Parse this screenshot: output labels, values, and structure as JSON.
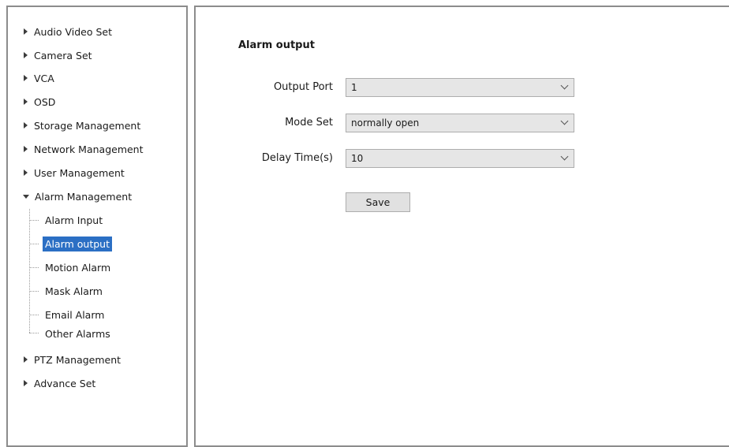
{
  "sidebar": {
    "items": [
      {
        "label": "Audio Video Set"
      },
      {
        "label": "Camera Set"
      },
      {
        "label": "VCA"
      },
      {
        "label": "OSD"
      },
      {
        "label": "Storage Management"
      },
      {
        "label": "Network Management"
      },
      {
        "label": "User Management"
      },
      {
        "label": "Alarm Management"
      },
      {
        "label": "PTZ Management"
      },
      {
        "label": "Advance Set"
      }
    ],
    "alarm_children": [
      {
        "label": "Alarm Input"
      },
      {
        "label": "Alarm output",
        "selected": true
      },
      {
        "label": "Motion Alarm"
      },
      {
        "label": "Mask Alarm"
      },
      {
        "label": "Email Alarm"
      },
      {
        "label": "Other Alarms"
      }
    ]
  },
  "main": {
    "title": "Alarm output",
    "fields": {
      "output_port": {
        "label": "Output Port",
        "value": "1"
      },
      "mode_set": {
        "label": "Mode Set",
        "value": "normally open"
      },
      "delay_time": {
        "label": "Delay Time(s)",
        "value": "10"
      }
    },
    "save_label": "Save"
  },
  "colors": {
    "selection": "#2b6fc4",
    "select_bg": "#e6e6e6",
    "panel_border": "#8c8c8c"
  }
}
